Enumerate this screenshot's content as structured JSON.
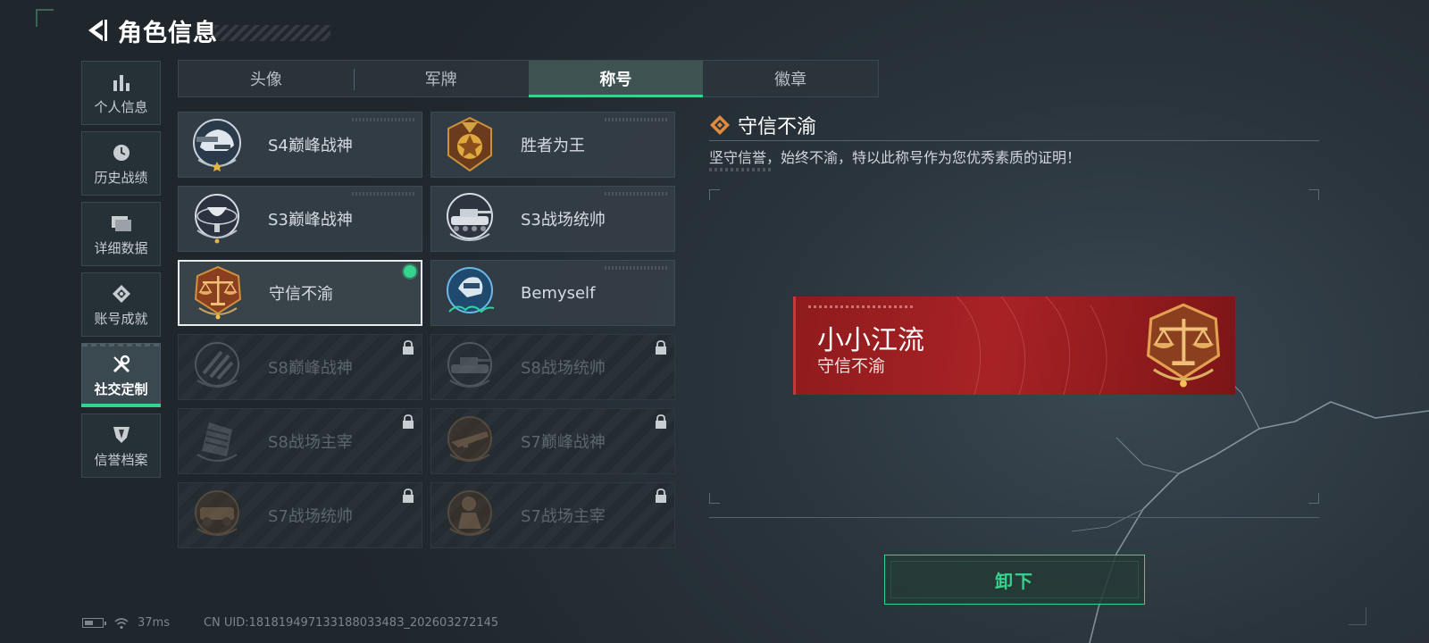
{
  "header": {
    "title": "角色信息"
  },
  "side_nav": [
    {
      "label": "个人信息",
      "icon": "bar-chart-icon",
      "active": false
    },
    {
      "label": "历史战绩",
      "icon": "clock-icon",
      "active": false
    },
    {
      "label": "详细数据",
      "icon": "folder-icon",
      "active": false
    },
    {
      "label": "账号成就",
      "icon": "achievement-icon",
      "active": false
    },
    {
      "label": "社交定制",
      "icon": "wrench-screwdriver-icon",
      "active": true
    },
    {
      "label": "信誉档案",
      "icon": "shield-icon",
      "active": false
    }
  ],
  "tabs": [
    {
      "label": "头像",
      "active": false
    },
    {
      "label": "军牌",
      "active": false
    },
    {
      "label": "称号",
      "active": true
    },
    {
      "label": "徽章",
      "active": false
    }
  ],
  "titles": [
    {
      "label": "S4巅峰战神",
      "emblem": "helmet-emblem",
      "locked": false,
      "selected": false
    },
    {
      "label": "胜者为王",
      "emblem": "gold-medal-emblem",
      "locked": false,
      "selected": false
    },
    {
      "label": "S3巅峰战神",
      "emblem": "globe-emblem",
      "locked": false,
      "selected": false
    },
    {
      "label": "S3战场统帅",
      "emblem": "tank-emblem",
      "locked": false,
      "selected": false
    },
    {
      "label": "守信不渝",
      "emblem": "scales-emblem",
      "locked": false,
      "selected": true
    },
    {
      "label": "Bemyself",
      "emblem": "rider-emblem",
      "locked": false,
      "selected": false
    },
    {
      "label": "S8巅峰战神",
      "emblem": "stripes-emblem",
      "locked": true,
      "selected": false
    },
    {
      "label": "S8战场统帅",
      "emblem": "tank-emblem",
      "locked": true,
      "selected": false
    },
    {
      "label": "S8战场主宰",
      "emblem": "building-emblem",
      "locked": true,
      "selected": false
    },
    {
      "label": "S7巅峰战神",
      "emblem": "rifle-emblem",
      "locked": true,
      "selected": false
    },
    {
      "label": "S7战场统帅",
      "emblem": "vehicle-emblem",
      "locked": true,
      "selected": false
    },
    {
      "label": "S7战场主宰",
      "emblem": "soldier-emblem",
      "locked": true,
      "selected": false
    }
  ],
  "detail": {
    "title": "守信不渝",
    "description": "坚守信誉，始终不渝，特以此称号作为您优秀素质的证明！",
    "player_name": "小小江流",
    "equipped_title": "守信不渝",
    "unequip_label": "卸下"
  },
  "status": {
    "ping": "37ms",
    "uid": "CN UID:18181949713318803348З_202603272145"
  },
  "colors": {
    "accent": "#35d48e",
    "nameplate_red": "#a82225",
    "background": "#2a343c"
  }
}
